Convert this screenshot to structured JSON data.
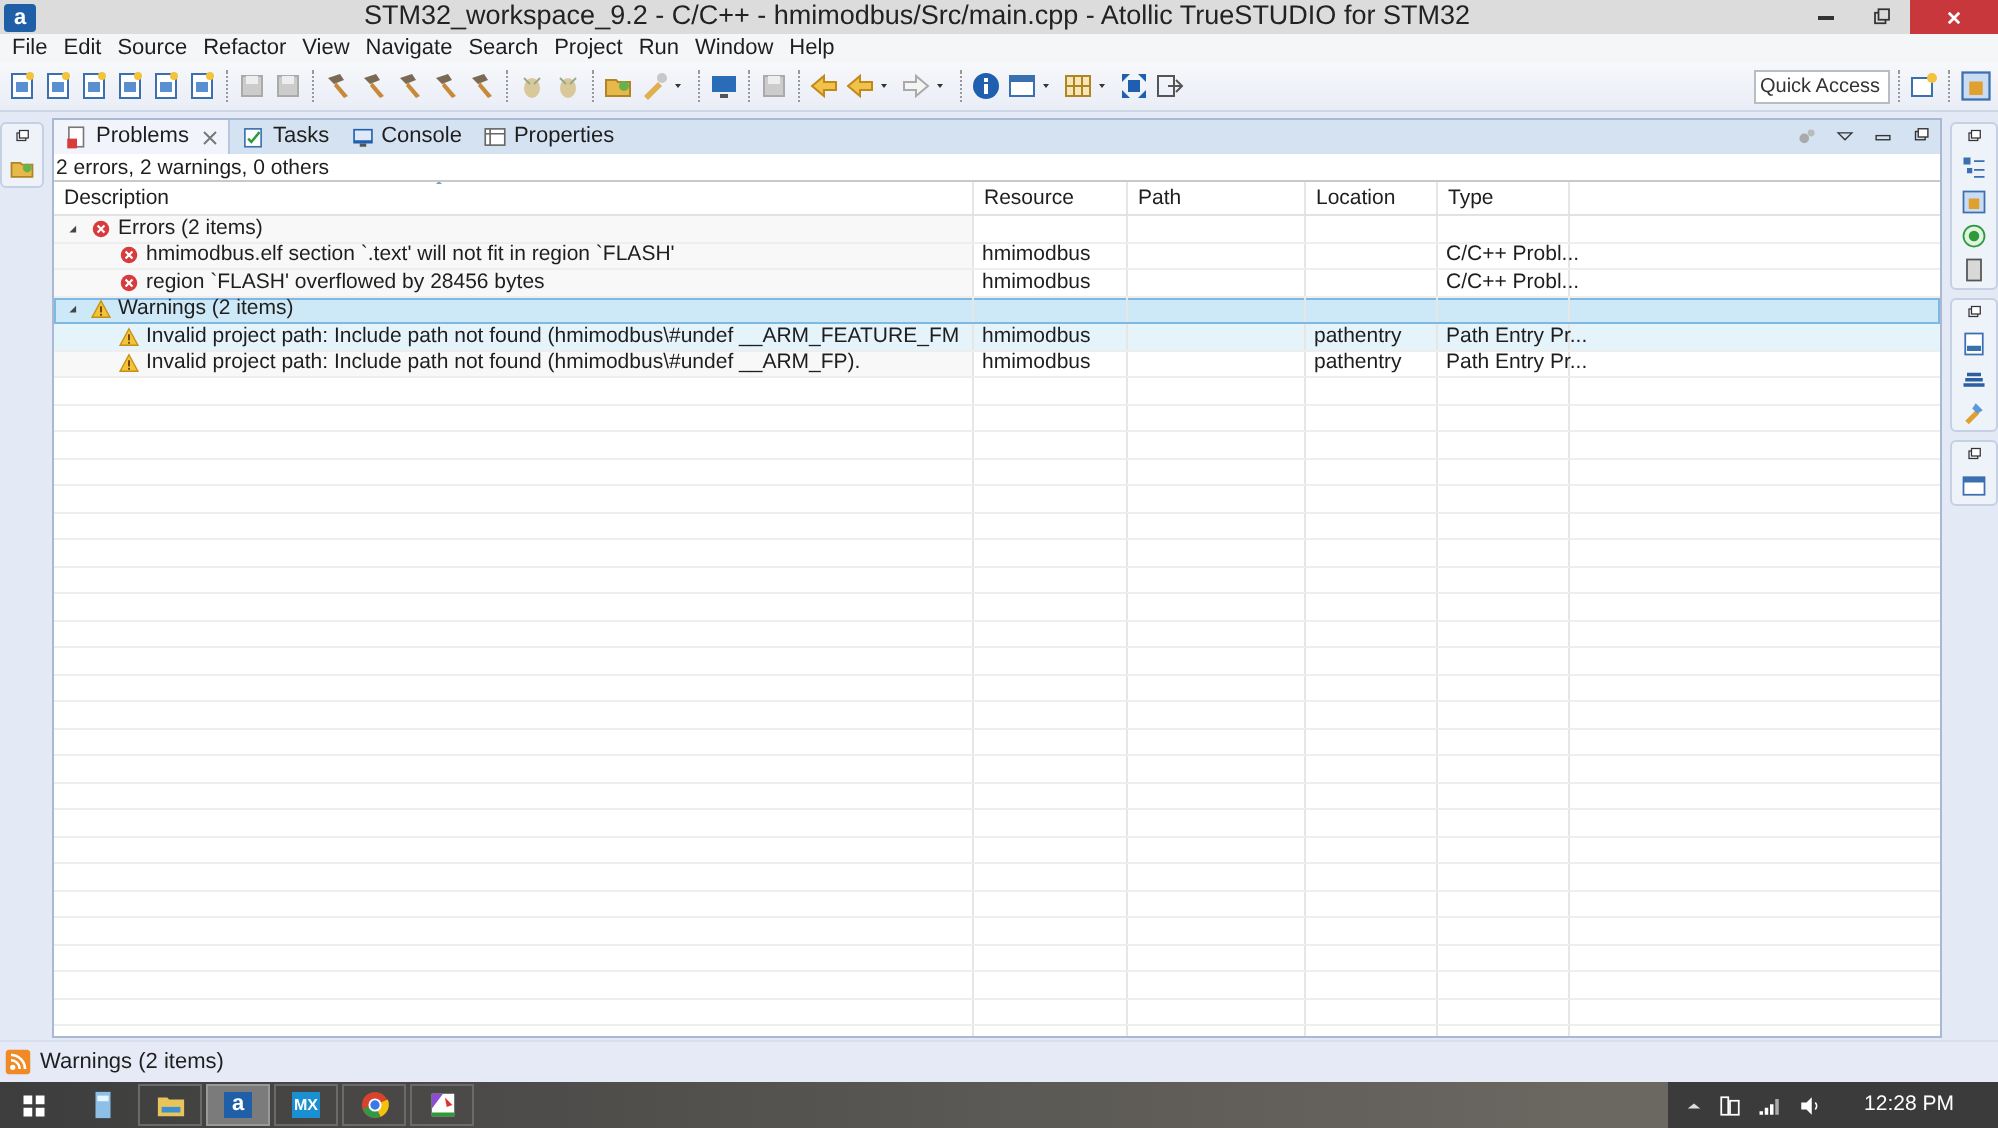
{
  "window": {
    "app_glyph": "a",
    "title": "STM32_workspace_9.2 - C/C++ - hmimodbus/Src/main.cpp - Atollic TrueSTUDIO for STM32"
  },
  "menu": [
    "File",
    "Edit",
    "Source",
    "Refactor",
    "View",
    "Navigate",
    "Search",
    "Project",
    "Run",
    "Window",
    "Help"
  ],
  "quick_access": {
    "placeholder": "Quick Access"
  },
  "problems_view": {
    "tabs": [
      {
        "label": "Problems",
        "kind": "problems",
        "selected": true
      },
      {
        "label": "Tasks",
        "kind": "tasks",
        "selected": false
      },
      {
        "label": "Console",
        "kind": "console",
        "selected": false
      },
      {
        "label": "Properties",
        "kind": "properties",
        "selected": false
      }
    ],
    "summary": "2 errors, 2 warnings, 0 others",
    "columns": [
      "Description",
      "Resource",
      "Path",
      "Location",
      "Type"
    ],
    "groups": [
      {
        "label": "Errors (2 items)",
        "kind": "error",
        "expanded": true,
        "selected": false,
        "children": [
          {
            "description": "hmimodbus.elf section `.text' will not fit in region `FLASH'",
            "resource": "hmimodbus",
            "type": "C/C++ Probl...",
            "kind": "error",
            "highlighted": false
          },
          {
            "description": "region `FLASH' overflowed by 28456 bytes",
            "resource": "hmimodbus",
            "type": "C/C++ Probl...",
            "kind": "error",
            "highlighted": false
          }
        ]
      },
      {
        "label": "Warnings (2 items)",
        "kind": "warning",
        "expanded": true,
        "selected": true,
        "children": [
          {
            "description": "Invalid project path: Include path not found (hmimodbus\\#undef __ARM_FEATURE_FM",
            "resource": "hmimodbus",
            "location": "pathentry",
            "type": "Path Entry Pr...",
            "kind": "warning",
            "highlighted": true
          },
          {
            "description": "Invalid project path: Include path not found (hmimodbus\\#undef __ARM_FP).",
            "resource": "hmimodbus",
            "location": "pathentry",
            "type": "Path Entry Pr...",
            "kind": "warning",
            "highlighted": false
          }
        ]
      }
    ]
  },
  "status_bar": {
    "text": "Warnings (2 items)"
  },
  "taskbar": {
    "apps": [
      {
        "kind": "calculator",
        "running": false,
        "active": false
      },
      {
        "kind": "explorer",
        "running": true,
        "active": false
      },
      {
        "kind": "glyph",
        "glyph": "a",
        "running": true,
        "active": true
      },
      {
        "kind": "glyph",
        "glyph": "MX",
        "running": true,
        "active": false
      },
      {
        "kind": "chrome",
        "running": true,
        "active": false
      },
      {
        "kind": "paint",
        "running": true,
        "active": false
      }
    ],
    "clock": "12:28 PM"
  }
}
